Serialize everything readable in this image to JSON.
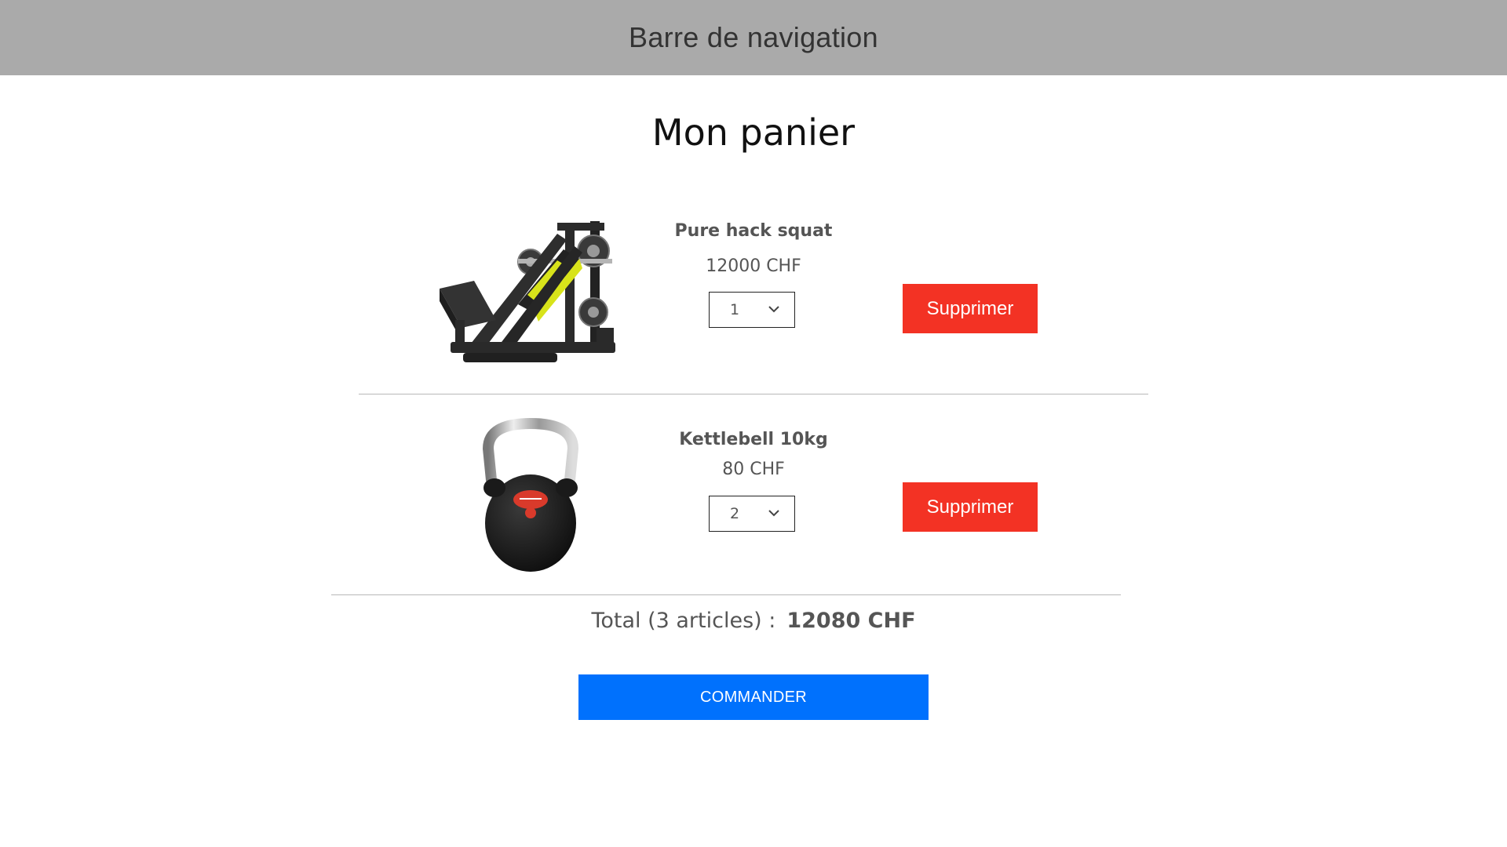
{
  "navbar": {
    "title": "Barre de navigation"
  },
  "page": {
    "title": "Mon panier"
  },
  "cart": {
    "items": [
      {
        "name": "Pure hack squat",
        "price": "12000 CHF",
        "quantity": "1",
        "delete_label": "Supprimer",
        "image_icon": "hack-squat-machine-icon"
      },
      {
        "name": "Kettlebell 10kg",
        "price": "80 CHF",
        "quantity": "2",
        "delete_label": "Supprimer",
        "image_icon": "kettlebell-icon"
      }
    ],
    "total_label": "Total (3 articles) :",
    "total_amount": "12080 CHF",
    "order_label": "COMMANDER"
  },
  "colors": {
    "navbar_bg": "#aaaaaa",
    "delete_button": "#f33224",
    "order_button": "#0071fd",
    "machine_accent": "#d8e31a"
  }
}
